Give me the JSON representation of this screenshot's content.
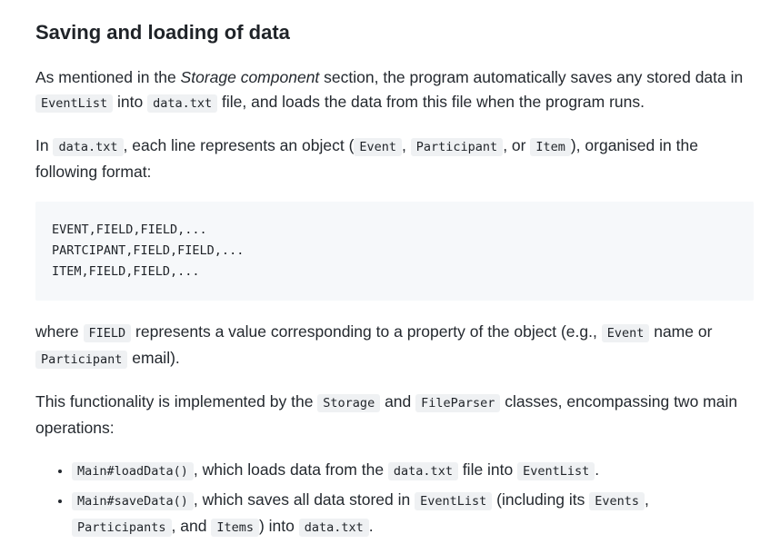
{
  "heading": "Saving and loading of data",
  "p1": {
    "t1": "As mentioned in the ",
    "em": "Storage component",
    "t2": " section, the program automatically saves any stored data in ",
    "c1": "EventList",
    "t3": " into ",
    "c2": "data.txt",
    "t4": " file, and loads the data from this file when the program runs."
  },
  "p2": {
    "t1": "In ",
    "c1": "data.txt",
    "t2": ", each line represents an object (",
    "c2": "Event",
    "t3": ", ",
    "c3": "Participant",
    "t4": ", or ",
    "c4": "Item",
    "t5": "), organised in the following format:"
  },
  "code_block": {
    "lines": [
      "EVENT,FIELD,FIELD,...",
      "PARTCIPANT,FIELD,FIELD,...",
      "ITEM,FIELD,FIELD,..."
    ]
  },
  "p3": {
    "t1": "where ",
    "c1": "FIELD",
    "t2": " represents a value corresponding to a property of the object (e.g., ",
    "c2": "Event",
    "t3": " name or ",
    "c3": "Participant",
    "t4": " email)."
  },
  "p4": {
    "t1": "This functionality is implemented by the ",
    "c1": "Storage",
    "t2": " and ",
    "c2": "FileParser",
    "t3": " classes, encompassing two main operations:"
  },
  "list": {
    "item1": {
      "c1": "Main#loadData()",
      "t1": ", which loads data from the ",
      "c2": "data.txt",
      "t2": " file into ",
      "c3": "EventList",
      "t3": "."
    },
    "item2": {
      "c1": "Main#saveData()",
      "t1": ", which saves all data stored in ",
      "c2": "EventList",
      "t2": " (including its ",
      "c3": "Events",
      "t3": ", ",
      "c4": "Participants",
      "t4": ", and ",
      "c5": "Items",
      "t5": ") into ",
      "c6": "data.txt",
      "t6": "."
    }
  }
}
